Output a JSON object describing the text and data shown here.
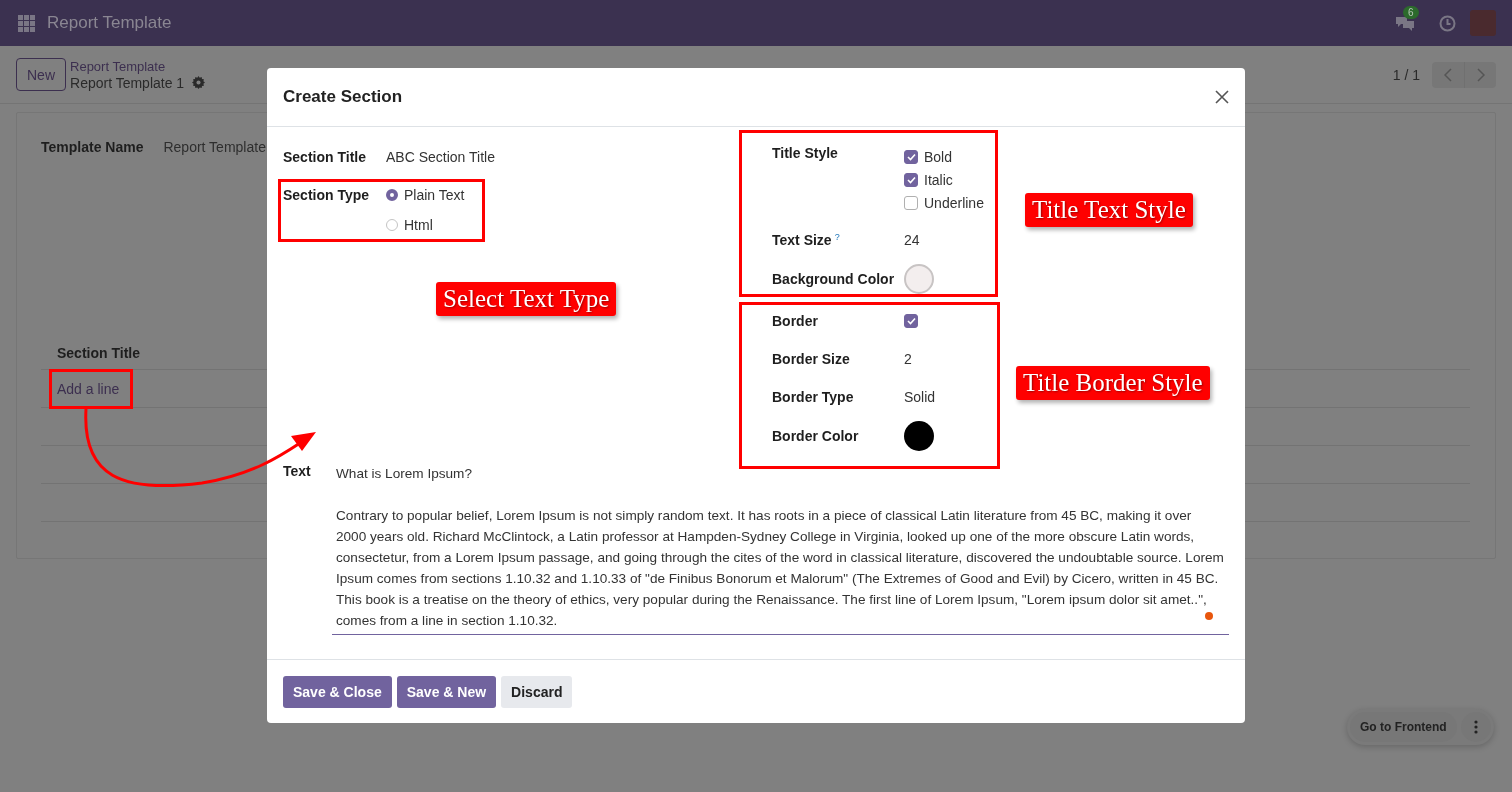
{
  "navbar": {
    "app_title": "Report Template",
    "messages_badge": "6"
  },
  "control_panel": {
    "new_button": "New",
    "breadcrumb": "Report Template",
    "record_title": "Report Template 1",
    "pager": "1 / 1"
  },
  "form": {
    "template_name_label": "Template Name",
    "template_name_value": "Report Template",
    "lines_column": "Section Title",
    "add_line": "Add a line"
  },
  "dialog": {
    "title": "Create Section",
    "section_title_label": "Section Title",
    "section_title_value": "ABC Section Title",
    "section_type_label": "Section Type",
    "section_types": [
      {
        "label": "Plain Text",
        "selected": true
      },
      {
        "label": "Html",
        "selected": false
      }
    ],
    "title_style_label": "Title Style",
    "title_styles": [
      {
        "label": "Bold",
        "checked": true
      },
      {
        "label": "Italic",
        "checked": true
      },
      {
        "label": "Underline",
        "checked": false
      }
    ],
    "text_size_label": "Text Size",
    "text_size_help": "?",
    "text_size_value": "24",
    "background_color": {
      "label": "Background Color",
      "color": "#f3eeee"
    },
    "border_label": "Border",
    "border_checked": true,
    "border_size_label": "Border Size",
    "border_size_value": "2",
    "border_type_label": "Border Type",
    "border_type_value": "Solid",
    "border_color": {
      "label": "Border Color",
      "color": "#000000"
    },
    "text_label": "Text",
    "text_paragraphs": [
      "What is Lorem Ipsum?",
      "Contrary to popular belief, Lorem Ipsum is not simply random text. It has roots in a piece of classical Latin literature from 45 BC, making it over 2000 years old. Richard McClintock, a Latin professor at Hampden-Sydney College in Virginia, looked up one of the more obscure Latin words, consectetur, from a Lorem Ipsum passage, and going through the cites of the word in classical literature, discovered the undoubtable source. Lorem Ipsum comes from sections 1.10.32 and 1.10.33 of \"de Finibus Bonorum et Malorum\" (The Extremes of Good and Evil) by Cicero, written in 45 BC. This book is a treatise on the theory of ethics, very popular during the Renaissance. The first line of Lorem Ipsum, \"Lorem ipsum dolor sit amet..\", comes from a line in section 1.10.32."
    ],
    "buttons": [
      {
        "label": "Save & Close",
        "kind": "primary"
      },
      {
        "label": "Save & New",
        "kind": "primary"
      },
      {
        "label": "Discard",
        "kind": "secondary"
      }
    ]
  },
  "annotations": [
    {
      "label": "Select Text Type"
    },
    {
      "label": "Title Text Style"
    },
    {
      "label": "Title Border Style"
    }
  ],
  "floating": {
    "go_to_frontend": "Go to Frontend"
  }
}
